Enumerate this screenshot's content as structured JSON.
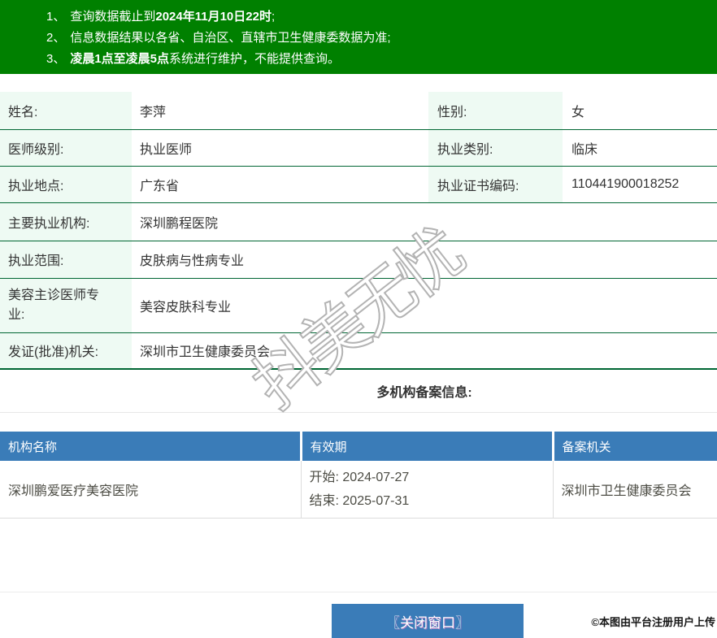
{
  "notice": {
    "items": [
      {
        "num": "1、",
        "seg1": "查询数据截止到",
        "seg2": "2024年11月10日22时",
        "seg3": ";"
      },
      {
        "num": "2、",
        "seg1": "信息数据结果以各省、自治区、直辖市卫生健康委数据为准;",
        "seg2": "",
        "seg3": ""
      },
      {
        "num": "3、",
        "seg1": "",
        "seg2": "凌晨1点至凌晨5点",
        "seg3": "系统进行维护，不能提供查询。"
      }
    ]
  },
  "info": {
    "rows4": [
      {
        "l1": "姓名:",
        "v1": "李萍",
        "l2": "性别:",
        "v2": "女"
      },
      {
        "l1": "医师级别:",
        "v1": "执业医师",
        "l2": "执业类别:",
        "v2": "临床"
      },
      {
        "l1": "执业地点:",
        "v1": "广东省",
        "l2": "执业证书编码:",
        "v2": "110441900018252"
      }
    ],
    "rows2": [
      {
        "l": "主要执业机构:",
        "v": "深圳鹏程医院"
      },
      {
        "l": "执业范围:",
        "v": "皮肤病与性病专业"
      },
      {
        "l": "美容主诊医师专业:",
        "v": "美容皮肤科专业"
      },
      {
        "l": "发证(批准)机关:",
        "v": "深圳市卫生健康委员会"
      }
    ]
  },
  "filing": {
    "title": "多机构备案信息:",
    "headers": [
      "机构名称",
      "有效期",
      "备案机关"
    ],
    "rows": [
      {
        "org": "深圳鹏爱医疗美容医院",
        "start": "开始: 2024-07-27",
        "end": "结束: 2025-07-31",
        "authority": "深圳市卫生健康委员会"
      }
    ]
  },
  "watermark": "抖美无忧",
  "close_button_label": "〖关闭窗口〗",
  "attribution": "©本图由平台注册用户上传",
  "colors": {
    "notice_green": "#008000",
    "row_line_green": "#006633",
    "label_bg_mint": "#eefaf3",
    "table_header_blue": "#3a7cb8",
    "button_blue": "#3a7cb8"
  }
}
